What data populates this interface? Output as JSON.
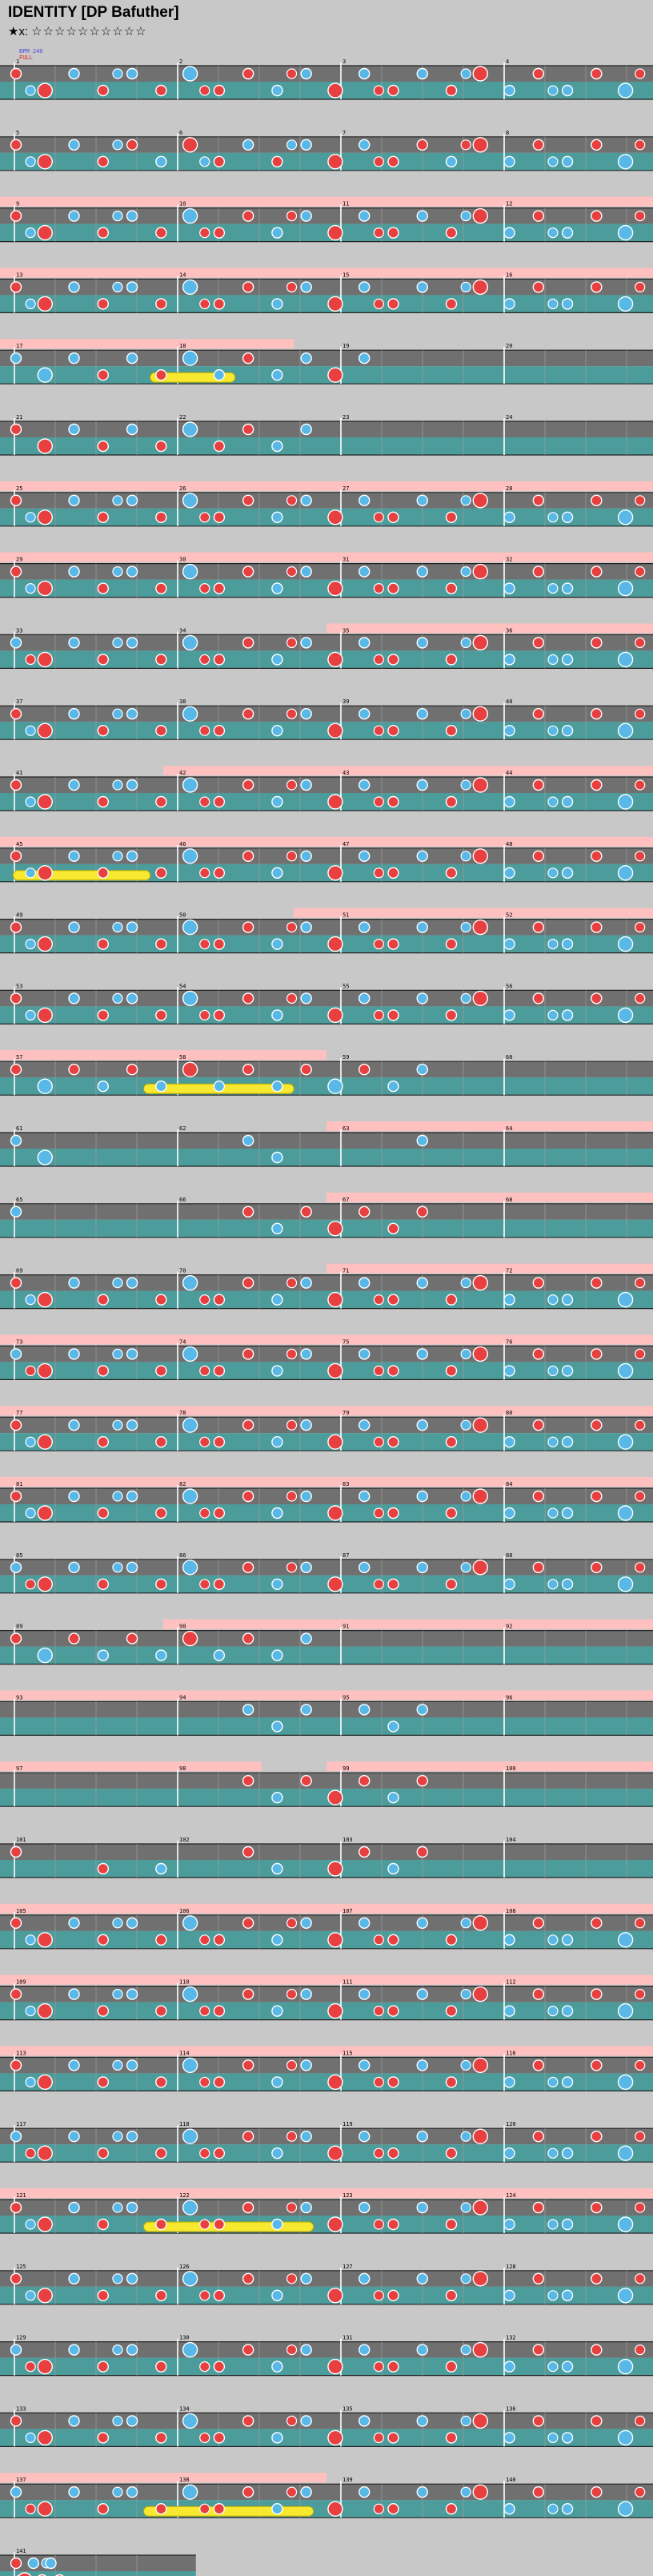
{
  "header": {
    "title": "IDENTITY [DP Bafuther]",
    "level_label": "★x:",
    "stars": "☆☆☆☆☆☆☆☆☆☆"
  },
  "bpm_tag": {
    "line1": "BPM 240",
    "line2": "FULL"
  },
  "rows": [
    {
      "labels": [
        "1",
        "2",
        "3",
        "4"
      ],
      "pink": [],
      "pattern": "ms",
      "notes": "R0 R1 B2 R3 B4 R5 B6 R7 R8 B9 B10 R11 B12 R13 B14 R15 R16 B17 R18 B19 R20 B21"
    },
    {
      "labels": [
        "5",
        "6",
        "7",
        "8"
      ],
      "pink": [],
      "pattern": "ms",
      "notes": "R0 R1 B2 R3 R4 B5 R6 R7 B8 R9 B10 R11 B12 R13 R14 B15 R16 B17 R18 B19 R20 B21"
    },
    {
      "labels": [
        "9",
        "10",
        "11",
        "12"
      ],
      "pink": [
        [
          0,
          1
        ]
      ],
      "pattern": "stream",
      "notes": "R0 R1 B2 R3 B4 R5 B6 R7 R8 B9 B10 R11 B12 R13 B14 R15 R16 B17 R18 B19 R20 B21"
    },
    {
      "labels": [
        "13",
        "14",
        "15",
        "16"
      ],
      "pink": [
        [
          0,
          1
        ]
      ],
      "pattern": "ms",
      "notes": "R0 R1 B2 R3 B4 R5 B6 R7 R8 B9 B10 R11 B12 R13 B14 R15 R16 B17 R18 B19 R20 B21"
    },
    {
      "labels": [
        "17",
        "18",
        "19",
        "20"
      ],
      "pink": [
        [
          0,
          0.45
        ]
      ],
      "pattern": "sparse",
      "yellow": [
        0.23,
        0.36
      ],
      "notes": "B0 B1 B2 R3 B4 R5 B6 B7 R8 B9 B10 R11 B12"
    },
    {
      "labels": [
        "21",
        "22",
        "23",
        "24"
      ],
      "pink": [],
      "pattern": "sparse",
      "notes": "R0 R1 B2 R3 B4 R5 B6 R7 R8 B9 B10"
    },
    {
      "labels": [
        "25",
        "26",
        "27",
        "28"
      ],
      "pink": [
        [
          0,
          1
        ]
      ],
      "pattern": "stream",
      "notes": "R0 R1 B2 R3 B4 R5 B6 R7 R8 B9 B10 R11 B12 R13 B14 R15 R16 B17 R18 B19 R20 B21"
    },
    {
      "labels": [
        "29",
        "30",
        "31",
        "32"
      ],
      "pink": [
        [
          0,
          1
        ]
      ],
      "pattern": "ms",
      "notes": "R0 R1 B2 R3 B4 R5 B6 R7 R8 B9 B10 R11 B12 R13 B14 R15 R16 B17 R18 B19 R20 B21"
    },
    {
      "labels": [
        "33",
        "34",
        "35",
        "36"
      ],
      "pink": [
        [
          0.5,
          1
        ]
      ],
      "pattern": "ms",
      "notes": "B0 R1 B2 R3 B4 R5 B6 R7 R8 B9 B10 R11 B12 R13 B14 R15 R16 B17 R18 B19 R20 B21"
    },
    {
      "labels": [
        "37",
        "38",
        "39",
        "40"
      ],
      "pink": [],
      "pattern": "ms",
      "notes": "R0 R1 B2 R3 B4 R5 B6 R7 R8 B9 B10 R11 B12 R13 B14 R15 R16 B17 R18 B19 R20 B21"
    },
    {
      "labels": [
        "41",
        "42",
        "43",
        "44"
      ],
      "pink": [
        [
          0.25,
          1
        ]
      ],
      "pattern": "ms",
      "notes": "R0 R1 B2 R3 B4 R5 B6 R7 R8 B9 B10 R11 B12 R13 B14 R15 R16 B17 R18 B19 R20 B21"
    },
    {
      "labels": [
        "45",
        "46",
        "47",
        "48"
      ],
      "pink": [
        [
          0,
          1
        ]
      ],
      "pattern": "ms",
      "yellow": [
        0.02,
        0.23
      ],
      "notes": "R0 R1 B2 R3 B4 R5 B6 R7 R8 B9 B10 R11 B12 R13 B14 R15 R16 B17 R18 B19 R20 B21"
    },
    {
      "labels": [
        "49",
        "50",
        "51",
        "52"
      ],
      "pink": [
        [
          0.45,
          1
        ]
      ],
      "pattern": "ms",
      "notes": "R0 R1 B2 R3 B4 R5 B6 R7 R8 B9 B10 R11 B12 R13 B14 R15 R16 B17 R18 B19 R20 B21"
    },
    {
      "labels": [
        "53",
        "54",
        "55",
        "56"
      ],
      "pink": [],
      "pattern": "ms",
      "notes": "R0 R1 B2 R3 B4 R5 B6 R7 R8 B9 B10 R11 B12 R13 B14 R15 R16 B17 R18 B19 R20 B21"
    },
    {
      "labels": [
        "57",
        "58",
        "59",
        "60"
      ],
      "pink": [
        [
          0,
          0.5
        ]
      ],
      "pattern": "sparse",
      "yellow": [
        0.22,
        0.45
      ],
      "notes": "R0 B1 R2 B3 R4 B5 R6 B7 R8 B9 R10 B11 R12 B13 B14"
    },
    {
      "labels": [
        "61",
        "62",
        "63",
        "64"
      ],
      "pink": [
        [
          0.5,
          1
        ]
      ],
      "pattern": "sparse",
      "notes": "B0 B1 B8 B9 B14"
    },
    {
      "labels": [
        "65",
        "66",
        "67",
        "68"
      ],
      "pink": [
        [
          0.5,
          1
        ]
      ],
      "pattern": "sparse",
      "notes": "B0 R8 B9 R10 R11 R12 R13 R14"
    },
    {
      "labels": [
        "69",
        "70",
        "71",
        "72"
      ],
      "pink": [
        [
          0.5,
          1
        ]
      ],
      "pattern": "ms",
      "notes": "R0 R1 B2 R3 B4 R5 B6 R7 R8 B9 B10 R11 B12 R13 B14 R15 R16 B17 R18 B19 R20 B21"
    },
    {
      "labels": [
        "73",
        "74",
        "75",
        "76"
      ],
      "pink": [
        [
          0,
          1
        ]
      ],
      "pattern": "ms",
      "notes": "B0 R1 B2 R3 B4 R5 B6 R7 R8 B9 B10 R11 B12 R13 B14 R15 R16 B17 R18 B19 R20 B21"
    },
    {
      "labels": [
        "77",
        "78",
        "79",
        "80"
      ],
      "pink": [
        [
          0,
          1
        ]
      ],
      "pattern": "ms",
      "notes": "R0 R1 B2 R3 B4 R5 B6 R7 R8 B9 B10 R11 B12 R13 B14 R15 R16 B17 R18 B19 R20 B21"
    },
    {
      "labels": [
        "81",
        "82",
        "83",
        "84"
      ],
      "pink": [
        [
          0,
          1
        ]
      ],
      "pattern": "ms",
      "notes": "R0 R1 B2 R3 B4 R5 B6 R7 R8 B9 B10 R11 B12 R13 B14 R15 R16 B17 R18 B19 R20 B21"
    },
    {
      "labels": [
        "85",
        "86",
        "87",
        "88"
      ],
      "pink": [],
      "pattern": "ms",
      "notes": "B0 R1 B2 R3 B4 R5 B6 R7 R8 B9 B10 R11 B12 R13 B14 R15 R16 B17 R18 B19 R20 B21"
    },
    {
      "labels": [
        "89",
        "90",
        "91",
        "92"
      ],
      "pink": [
        [
          0.25,
          1
        ]
      ],
      "pattern": "sparse",
      "notes": "R0 B1 R2 B3 R4 B5 R6 B7 R8 B9 B10"
    },
    {
      "labels": [
        "93",
        "94",
        "95",
        "96"
      ],
      "pink": [
        [
          0,
          1
        ]
      ],
      "pattern": "sparse",
      "notes": "B8 B9 B10 B12 B13 B14"
    },
    {
      "labels": [
        "97",
        "98",
        "99",
        "100"
      ],
      "pink": [
        [
          0,
          0.4
        ],
        [
          0.5,
          1
        ]
      ],
      "pattern": "sparse",
      "notes": "R8 B9 R10 R11 R12 B13 R14"
    },
    {
      "labels": [
        "101",
        "102",
        "103",
        "104"
      ],
      "pink": [],
      "pattern": "sparse",
      "notes": "R0 R3 B5 R8 B9 R11 R12 B13 R14"
    },
    {
      "labels": [
        "105",
        "106",
        "107",
        "108"
      ],
      "pink": [
        [
          0,
          1
        ]
      ],
      "pattern": "ms",
      "notes": "R0 R1 B2 R3 B4 R5 B6 R7 R8 B9 B10 R11 B12 R13 B14 R15 R16 B17 R18 B19 R20 B21"
    },
    {
      "labels": [
        "109",
        "110",
        "111",
        "112"
      ],
      "pink": [
        [
          0,
          1
        ]
      ],
      "pattern": "ms",
      "notes": "R0 R1 B2 R3 B4 R5 B6 R7 R8 B9 B10 R11 B12 R13 B14 R15 R16 B17 R18 B19 R20 B21"
    },
    {
      "labels": [
        "113",
        "114",
        "115",
        "116"
      ],
      "pink": [
        [
          0,
          1
        ]
      ],
      "pattern": "ms",
      "notes": "R0 R1 B2 R3 B4 R5 B6 R7 R8 B9 B10 R11 B12 R13 B14 R15 R16 B17 R18 B19 R20 B21"
    },
    {
      "labels": [
        "117",
        "118",
        "119",
        "120"
      ],
      "pink": [],
      "pattern": "ms",
      "notes": "B0 R1 B2 R3 B4 R5 B6 R7 R8 B9 B10 R11 B12 R13 B14 R15 R16 B17 R18 B19 R20 B21"
    },
    {
      "labels": [
        "121",
        "122",
        "123",
        "124"
      ],
      "pink": [
        [
          0,
          1
        ]
      ],
      "pattern": "ms",
      "yellow": [
        0.22,
        0.48
      ],
      "notes": "R0 R1 B2 R3 B4 R5 B6 R7 R8 B9 B10 R11 B12 R13 B14 R15 R16 B17 R18 B19 R20 B21"
    },
    {
      "labels": [
        "125",
        "126",
        "127",
        "128"
      ],
      "pink": [],
      "pattern": "ms",
      "notes": "R0 R1 B2 R3 B4 R5 B6 R7 R8 B9 B10 R11 B12 R13 B14 R15 R16 B17 R18 B19 R20 B21"
    },
    {
      "labels": [
        "129",
        "130",
        "131",
        "132"
      ],
      "pink": [],
      "pattern": "ms",
      "notes": "B0 R1 B2 R3 B4 R5 B6 R7 R8 B9 B10 R11 B12 R13 B14 R15 R16 B17 R18 B19 R20 B21"
    },
    {
      "labels": [
        "133",
        "134",
        "135",
        "136"
      ],
      "pink": [],
      "pattern": "ms",
      "notes": "R0 R1 B2 R3 B4 R5 B6 R7 R8 B9 B10 R11 B12 R13 B14 R15 R16 B17 R18 B19 R20 B21"
    },
    {
      "labels": [
        "137",
        "138",
        "139",
        "140"
      ],
      "pink": [
        [
          0,
          0.5
        ]
      ],
      "pattern": "ms",
      "yellow": [
        0.22,
        0.48
      ],
      "notes": "B0 R1 B2 R3 B4 R5 B6 R7 R8 B9 B10 R11 B12 R13 B14 R15 R16 B17 R18 B19 R20 B21"
    },
    {
      "labels": [
        "141"
      ],
      "pink": [],
      "pattern": "ms",
      "partial": 0.3,
      "notes": "R0 R1 B2 R3 B4 R5"
    }
  ],
  "colors": {
    "band_dark": "#707070",
    "band_teal": "#4c9c9c",
    "pink": "#ffc0c0",
    "note_red": "#e84040",
    "note_blue": "#58b8e8",
    "yellow": "#f8e830"
  }
}
